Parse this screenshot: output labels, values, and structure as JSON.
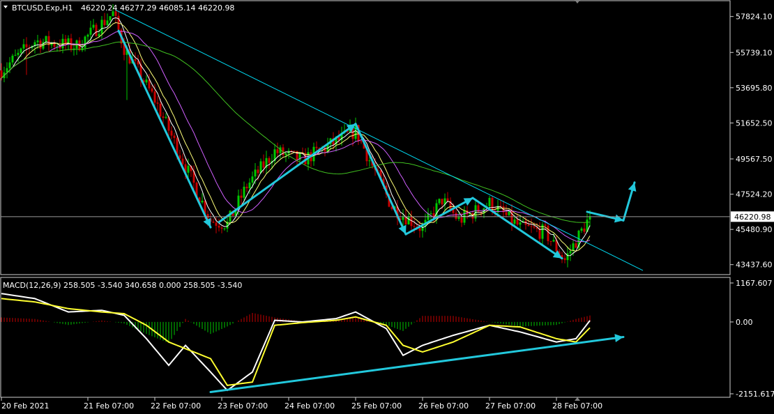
{
  "symbol_label": "BTCUSD.Exp,H1",
  "ohlc_label": "46220.24 46277.29 46085.14 46220.98",
  "price_scale": {
    "ticks": [
      "57824.10",
      "55739.10",
      "53695.80",
      "51652.50",
      "49567.50",
      "47524.20",
      "45480.90",
      "43437.60"
    ],
    "current_price": "46220.98"
  },
  "macd": {
    "label": "MACD(12,26,9) 258.505 -3.540 340.658 0.000 258.505 -3.540",
    "ticks": [
      "1167.607",
      "0.00",
      "-2151.617"
    ]
  },
  "time_axis": [
    "20 Feb 2021",
    "21 Feb 07:00",
    "22 Feb 07:00",
    "23 Feb 07:00",
    "24 Feb 07:00",
    "25 Feb 07:00",
    "26 Feb 07:00",
    "27 Feb 07:00",
    "28 Feb 07:00"
  ],
  "colors": {
    "bull_candle": "#00c800",
    "bear_candle": "#c80000",
    "trendline": "#00d8f0",
    "arrows": "#22c8dc",
    "ma_fast": "#ffffff",
    "ma_mid": "#ffff7a",
    "ma_slow": "#d060ff",
    "ma_long": "#40c020",
    "macd_line": "#ffffff",
    "signal_line": "#ffff30"
  },
  "chart_data": [
    {
      "type": "candlestick",
      "title": "BTCUSD.Exp,H1",
      "ylim": [
        42900,
        58700
      ],
      "x_range": [
        "20 Feb 2021",
        "28 Feb 21:00"
      ],
      "current_price": 46220.98,
      "price_path": [
        [
          "20 Feb 2021",
          54700
        ],
        [
          "20 Feb 12:00",
          56400
        ],
        [
          "21 Feb 03:00",
          56100
        ],
        [
          "21 Feb 16:00",
          58000
        ],
        [
          "21 Feb 20:00",
          56000
        ],
        [
          "22 Feb 07:00",
          53000
        ],
        [
          "22 Feb 17:00",
          49500
        ],
        [
          "23 Feb 03:00",
          46000
        ],
        [
          "23 Feb 09:00",
          45800
        ],
        [
          "23 Feb 16:00",
          48000
        ],
        [
          "24 Feb 02:00",
          50000
        ],
        [
          "24 Feb 12:00",
          49500
        ],
        [
          "25 Feb 07:00",
          51200
        ],
        [
          "25 Feb 20:00",
          46800
        ],
        [
          "26 Feb 07:00",
          45500
        ],
        [
          "26 Feb 14:00",
          47200
        ],
        [
          "26 Feb 20:00",
          46000
        ],
        [
          "27 Feb 07:00",
          47000
        ],
        [
          "27 Feb 18:00",
          45600
        ],
        [
          "28 Feb 03:00",
          45300
        ],
        [
          "28 Feb 10:00",
          43700
        ],
        [
          "28 Feb 19:00",
          46220
        ]
      ],
      "trendline": [
        [
          "21 Feb 17:00",
          58200
        ],
        [
          "1 Mar 14:00",
          43100
        ]
      ],
      "arrows": [
        [
          [
            "21 Feb 18:00",
            57000
          ],
          [
            "23 Feb 03:00",
            45600
          ]
        ],
        [
          [
            "23 Feb 06:00",
            45900
          ],
          [
            "25 Feb 07:00",
            51600
          ]
        ],
        [
          [
            "25 Feb 07:00",
            51600
          ],
          [
            "26 Feb 01:00",
            45200
          ]
        ],
        [
          [
            "26 Feb 01:00",
            45200
          ],
          [
            "27 Feb 01:00",
            47300
          ]
        ],
        [
          [
            "27 Feb 01:00",
            47300
          ],
          [
            "28 Feb 09:00",
            43800
          ]
        ],
        [
          [
            "28 Feb 18:00",
            46500
          ],
          [
            "1 Mar 07:00",
            46000
          ]
        ],
        [
          [
            "1 Mar 07:00",
            46000
          ],
          [
            "1 Mar 11:00",
            48200
          ]
        ]
      ]
    },
    {
      "type": "line",
      "title": "MACD(12,26,9)",
      "ylim": [
        -2151.617,
        1167.607
      ],
      "macd": 258.505,
      "signal": -3.54,
      "histogram": 340.658,
      "series": [
        {
          "values": [
            [
              "20 Feb 2021",
              850
            ],
            [
              "20 Feb 12:00",
              700
            ],
            [
              "21 Feb 00:00",
              300
            ],
            [
              "21 Feb 12:00",
              350
            ],
            [
              "21 Feb 20:00",
              200
            ],
            [
              "22 Feb 04:00",
              -500
            ],
            [
              "22 Feb 12:00",
              -1300
            ],
            [
              "22 Feb 18:00",
              -700
            ],
            [
              "23 Feb 03:00",
              -1500
            ],
            [
              "23 Feb 09:00",
              -2050
            ],
            [
              "23 Feb 18:00",
              -1500
            ],
            [
              "24 Feb 02:00",
              50
            ],
            [
              "24 Feb 12:00",
              0
            ],
            [
              "25 Feb 00:00",
              100
            ],
            [
              "25 Feb 07:00",
              300
            ],
            [
              "25 Feb 18:00",
              -200
            ],
            [
              "26 Feb 00:00",
              -1000
            ],
            [
              "26 Feb 07:00",
              -700
            ],
            [
              "26 Feb 18:00",
              -400
            ],
            [
              "27 Feb 07:00",
              -100
            ],
            [
              "27 Feb 18:00",
              -300
            ],
            [
              "28 Feb 07:00",
              -600
            ],
            [
              "28 Feb 14:00",
              -500
            ],
            [
              "28 Feb 21:00",
              258.505
            ]
          ]
        },
        {
          "values": [
            [
              "20 Feb 2021",
              700
            ],
            [
              "20 Feb 12:00",
              600
            ],
            [
              "21 Feb 00:00",
              400
            ],
            [
              "21 Feb 12:00",
              300
            ],
            [
              "21 Feb 20:00",
              250
            ],
            [
              "22 Feb 04:00",
              -100
            ],
            [
              "22 Feb 12:00",
              -600
            ],
            [
              "22 Feb 18:00",
              -800
            ],
            [
              "23 Feb 03:00",
              -1100
            ],
            [
              "23 Feb 09:00",
              -1900
            ],
            [
              "23 Feb 18:00",
              -1800
            ],
            [
              "24 Feb 02:00",
              -100
            ],
            [
              "24 Feb 12:00",
              -20
            ],
            [
              "25 Feb 00:00",
              50
            ],
            [
              "25 Feb 07:00",
              150
            ],
            [
              "25 Feb 18:00",
              -100
            ],
            [
              "26 Feb 00:00",
              -700
            ],
            [
              "26 Feb 07:00",
              -900
            ],
            [
              "26 Feb 18:00",
              -600
            ],
            [
              "27 Feb 07:00",
              -100
            ],
            [
              "27 Feb 18:00",
              -150
            ],
            [
              "28 Feb 07:00",
              -500
            ],
            [
              "28 Feb 14:00",
              -600
            ],
            [
              "28 Feb 21:00",
              -3.54
            ]
          ]
        }
      ],
      "arrow": [
        [
          "23 Feb 03:00",
          -2100
        ],
        [
          "1 Mar 07:00",
          -450
        ]
      ]
    }
  ]
}
